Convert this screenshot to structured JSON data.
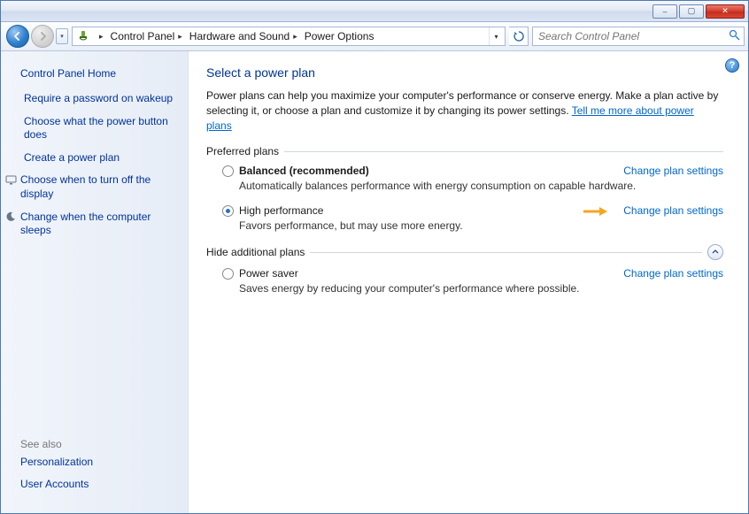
{
  "titlebar": {
    "minimize": "–",
    "maximize": "▢",
    "close": "✕"
  },
  "breadcrumb": {
    "items": [
      "Control Panel",
      "Hardware and Sound",
      "Power Options"
    ]
  },
  "search": {
    "placeholder": "Search Control Panel"
  },
  "sidebar": {
    "home": "Control Panel Home",
    "tasks": [
      {
        "label": "Require a password on wakeup",
        "icon": ""
      },
      {
        "label": "Choose what the power button does",
        "icon": ""
      },
      {
        "label": "Create a power plan",
        "icon": ""
      },
      {
        "label": "Choose when to turn off the display",
        "icon": "display"
      },
      {
        "label": "Change when the computer sleeps",
        "icon": "sleep"
      }
    ],
    "seealso_head": "See also",
    "seealso": [
      "Personalization",
      "User Accounts"
    ]
  },
  "content": {
    "heading": "Select a power plan",
    "intro_a": "Power plans can help you maximize your computer's performance or conserve energy. Make a plan active by selecting it, or choose a plan and customize it by changing its power settings. ",
    "intro_link": "Tell me more about power plans",
    "preferred_head": "Preferred plans",
    "hide_head": "Hide additional plans",
    "change_link": "Change plan settings",
    "plans_preferred": [
      {
        "name": "Balanced (recommended)",
        "desc": "Automatically balances performance with energy consumption on capable hardware.",
        "selected": false,
        "bold": true,
        "arrow": false
      },
      {
        "name": "High performance",
        "desc": "Favors performance, but may use more energy.",
        "selected": true,
        "bold": false,
        "arrow": true
      }
    ],
    "plans_additional": [
      {
        "name": "Power saver",
        "desc": "Saves energy by reducing your computer's performance where possible.",
        "selected": false,
        "bold": false,
        "arrow": false
      }
    ]
  }
}
